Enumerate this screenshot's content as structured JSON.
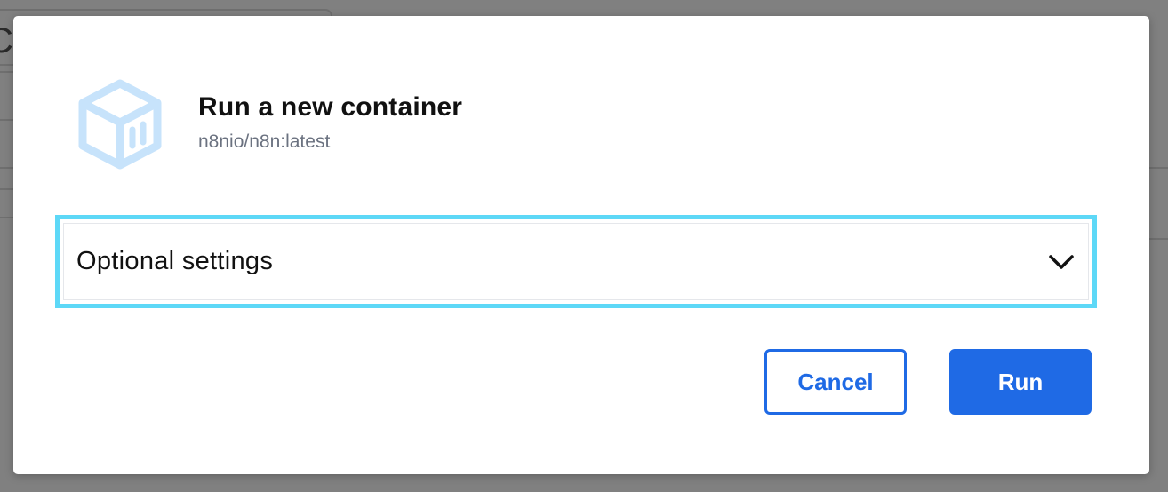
{
  "dialog": {
    "title": "Run a new container",
    "image_name": "n8nio/n8n:latest",
    "icon": "container-cube-icon",
    "optional_settings": {
      "label": "Optional settings",
      "icon": "chevron-down-icon",
      "expanded": false
    },
    "buttons": {
      "cancel_label": "Cancel",
      "run_label": "Run"
    }
  },
  "colors": {
    "accent": "#1f6ae5",
    "focus_ring": "#5dd8f7",
    "overlay": "#808080",
    "icon_tint": "#c7e3fb"
  }
}
